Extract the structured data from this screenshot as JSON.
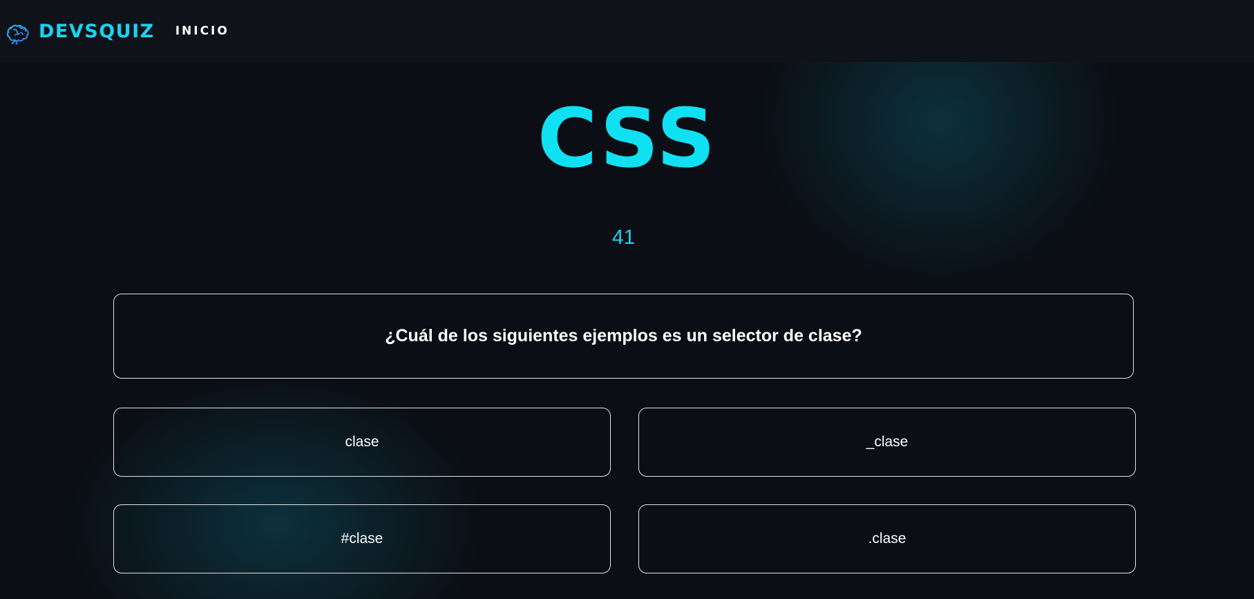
{
  "nav": {
    "brand_name": "DEVSQUIZ",
    "brand_icon": "brain-icon",
    "links": [
      {
        "label": "INICIO"
      }
    ]
  },
  "quiz": {
    "title": "CSS",
    "counter": "41",
    "question": "¿Cuál de los siguientes ejemplos es un selector de clase?",
    "options": [
      {
        "label": "clase"
      },
      {
        "label": "_clase"
      },
      {
        "label": "#clase"
      },
      {
        "label": ".clase"
      }
    ]
  },
  "colors": {
    "accent": "#0fe1f2",
    "background": "#0b0e15",
    "navbar": "#101319",
    "border": "#e6e6e6"
  }
}
